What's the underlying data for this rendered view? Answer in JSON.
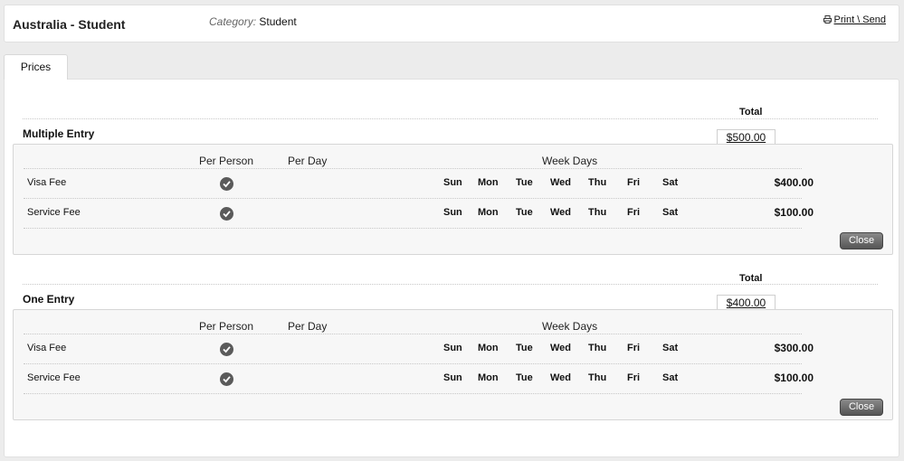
{
  "header": {
    "title": "Australia - Student",
    "category_label": "Category:",
    "category_value": "Student",
    "print_label": "Print \\ Send"
  },
  "tabs": [
    {
      "label": "Prices"
    }
  ],
  "sections": [
    {
      "title": "Multiple Entry",
      "total_label": "Total",
      "total_value": "$500.00",
      "col_per_person": "Per Person",
      "col_per_day": "Per Day",
      "col_week_days": "Week Days",
      "rows": [
        {
          "name": "Visa Fee",
          "per_person": true,
          "days": [
            "Sun",
            "Mon",
            "Tue",
            "Wed",
            "Thu",
            "Fri",
            "Sat"
          ],
          "amount": "$400.00"
        },
        {
          "name": "Service Fee",
          "per_person": true,
          "days": [
            "Sun",
            "Mon",
            "Tue",
            "Wed",
            "Thu",
            "Fri",
            "Sat"
          ],
          "amount": "$100.00"
        }
      ],
      "close_label": "Close"
    },
    {
      "title": "One Entry",
      "total_label": "Total",
      "total_value": "$400.00",
      "col_per_person": "Per Person",
      "col_per_day": "Per Day",
      "col_week_days": "Week Days",
      "rows": [
        {
          "name": "Visa Fee",
          "per_person": true,
          "days": [
            "Sun",
            "Mon",
            "Tue",
            "Wed",
            "Thu",
            "Fri",
            "Sat"
          ],
          "amount": "$300.00"
        },
        {
          "name": "Service Fee",
          "per_person": true,
          "days": [
            "Sun",
            "Mon",
            "Tue",
            "Wed",
            "Thu",
            "Fri",
            "Sat"
          ],
          "amount": "$100.00"
        }
      ],
      "close_label": "Close"
    }
  ]
}
